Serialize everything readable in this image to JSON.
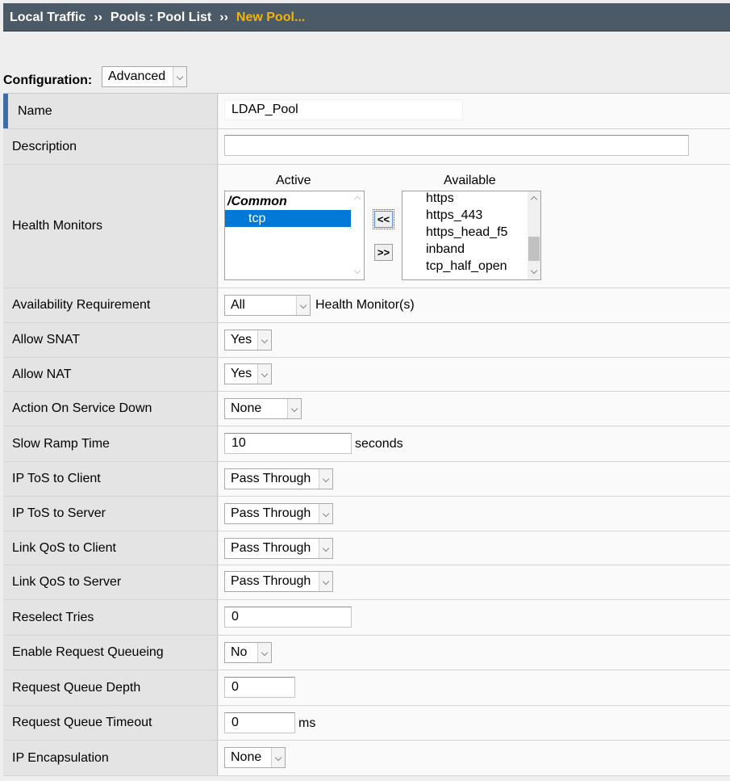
{
  "breadcrumb": {
    "part1": "Local Traffic",
    "sep": "››",
    "part2": "Pools : Pool List",
    "current": "New Pool..."
  },
  "configuration": {
    "label": "Configuration:",
    "value": "Advanced"
  },
  "fields": {
    "name": {
      "label": "Name",
      "value": "LDAP_Pool"
    },
    "description": {
      "label": "Description",
      "value": ""
    },
    "health_monitors": {
      "label": "Health Monitors",
      "active_header": "Active",
      "available_header": "Available",
      "active_group": "/Common",
      "active_items": [
        "tcp"
      ],
      "available_items": [
        "https",
        "https_443",
        "https_head_f5",
        "inband",
        "tcp_half_open"
      ],
      "move_left_label": "<<",
      "move_right_label": ">>"
    },
    "availability_requirement": {
      "label": "Availability Requirement",
      "value": "All",
      "suffix": "Health Monitor(s)"
    },
    "allow_snat": {
      "label": "Allow SNAT",
      "value": "Yes"
    },
    "allow_nat": {
      "label": "Allow NAT",
      "value": "Yes"
    },
    "action_on_service_down": {
      "label": "Action On Service Down",
      "value": "None"
    },
    "slow_ramp_time": {
      "label": "Slow Ramp Time",
      "value": "10",
      "suffix": "seconds"
    },
    "ip_tos_client": {
      "label": "IP ToS to Client",
      "value": "Pass Through"
    },
    "ip_tos_server": {
      "label": "IP ToS to Server",
      "value": "Pass Through"
    },
    "link_qos_client": {
      "label": "Link QoS to Client",
      "value": "Pass Through"
    },
    "link_qos_server": {
      "label": "Link QoS to Server",
      "value": "Pass Through"
    },
    "reselect_tries": {
      "label": "Reselect Tries",
      "value": "0"
    },
    "enable_request_queueing": {
      "label": "Enable Request Queueing",
      "value": "No"
    },
    "request_queue_depth": {
      "label": "Request Queue Depth",
      "value": "0"
    },
    "request_queue_timeout": {
      "label": "Request Queue Timeout",
      "value": "0",
      "suffix": "ms"
    },
    "ip_encapsulation": {
      "label": "IP Encapsulation",
      "value": "None"
    }
  },
  "colors": {
    "header_bg": "#4c5966",
    "breadcrumb_current": "#f5b400",
    "label_bg": "#e4e4e4",
    "selected_item": "#0078d7",
    "accent_bar": "#3d6da5"
  }
}
